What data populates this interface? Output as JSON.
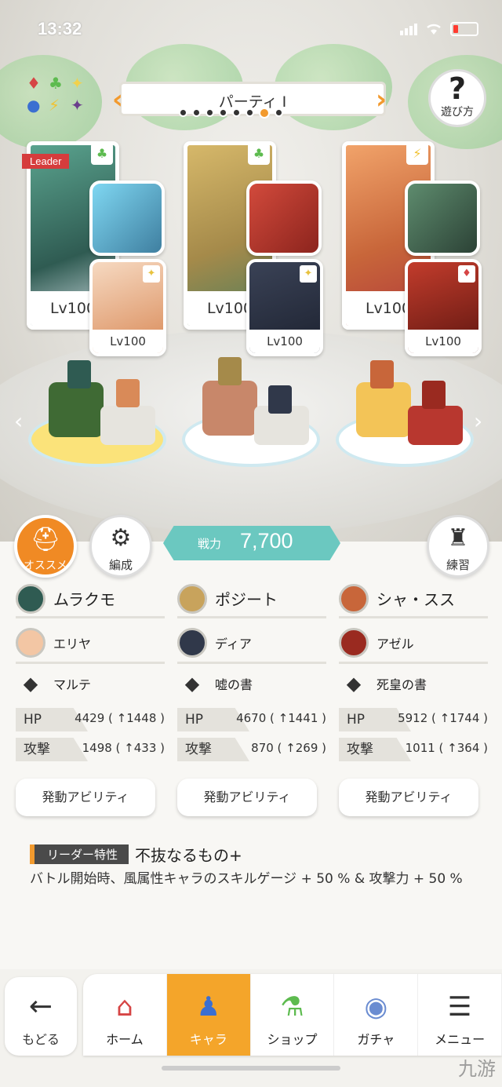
{
  "status": {
    "time": "13:32"
  },
  "element_icons": [
    "♦",
    "♣",
    "✦",
    "●",
    "⚡",
    "✦"
  ],
  "party": {
    "title": "パーティ I",
    "dots_total": 8,
    "active_dot": 7
  },
  "help": {
    "label": "遊び方"
  },
  "leader_tag": "Leader",
  "cards": [
    {
      "level": "Lv100",
      "element": "♣",
      "sub_level": "Lv100",
      "sub_element": "✦",
      "color": "#2f5b52",
      "equip_color": "#3f7fa0",
      "sub_color": "#f3c6a4"
    },
    {
      "level": "Lv100",
      "element": "♣",
      "sub_level": "Lv100",
      "sub_element": "✦",
      "color": "#a58a4a",
      "equip_color": "#b8372f",
      "sub_color": "#30384a"
    },
    {
      "level": "Lv100",
      "element": "⚡",
      "sub_level": "Lv100",
      "sub_element": "♦",
      "color": "#c8663a",
      "equip_color": "#3b5b48",
      "sub_color": "#9a2a20"
    }
  ],
  "actions": {
    "recommend": "オススメ",
    "formation": "編成",
    "practice": "練習"
  },
  "power": {
    "label": "戦力",
    "value": "7,700"
  },
  "columns": [
    {
      "name": "ムラクモ",
      "sub": "エリヤ",
      "weapon": "マルテ",
      "hp_label": "HP",
      "hp": "4429 ( ↑1448 )",
      "atk_label": "攻撃",
      "atk": "1498 ( ↑433 )",
      "ability": "発動アビリティ"
    },
    {
      "name": "ポジート",
      "sub": "ディア",
      "weapon": "嘘の書",
      "hp_label": "HP",
      "hp": "4670 ( ↑1441 )",
      "atk_label": "攻撃",
      "atk": "870 ( ↑269 )",
      "ability": "発動アビリティ"
    },
    {
      "name": "シャ・スス",
      "sub": "アゼル",
      "weapon": "死皇の書",
      "hp_label": "HP",
      "hp": "5912 ( ↑1744 )",
      "atk_label": "攻撃",
      "atk": "1011 ( ↑364 )",
      "ability": "発動アビリティ"
    }
  ],
  "leader_trait": {
    "tag": "リーダー特性",
    "name": "不抜なるもの+",
    "description": "バトル開始時、風属性キャラのスキルゲージ + 50 % & 攻撃力 + 50 %"
  },
  "nav": {
    "back": "もどる",
    "tabs": [
      {
        "label": "ホーム",
        "icon": "home-icon"
      },
      {
        "label": "キャラ",
        "icon": "character-icon"
      },
      {
        "label": "ショップ",
        "icon": "shop-icon"
      },
      {
        "label": "ガチャ",
        "icon": "gacha-icon"
      },
      {
        "label": "メニュー",
        "icon": "menu-icon"
      }
    ],
    "active_tab": 1
  },
  "watermark": "九游"
}
